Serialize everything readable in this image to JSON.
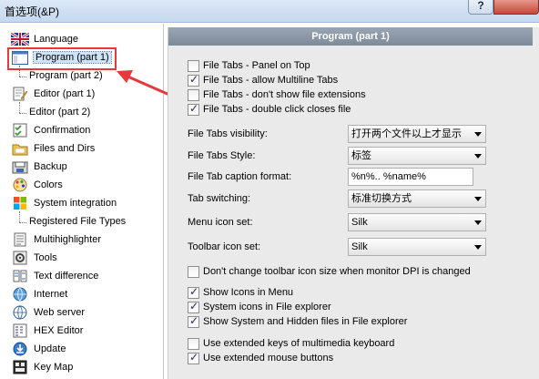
{
  "window": {
    "title": "首选项(&P)",
    "help_label": "?"
  },
  "sidebar": {
    "items": [
      {
        "name": "language",
        "label": "Language",
        "icon": "flag-icon"
      },
      {
        "name": "program-part1",
        "label": "Program  (part 1)",
        "icon": "window-icon",
        "selected": true
      },
      {
        "name": "program-part2",
        "label": "Program  (part 2)",
        "icon": ""
      },
      {
        "name": "editor-part1",
        "label": "Editor  (part 1)",
        "icon": "edit-icon"
      },
      {
        "name": "editor-part2",
        "label": "Editor  (part 2)",
        "icon": ""
      },
      {
        "name": "confirmation",
        "label": "Confirmation",
        "icon": "checklist-icon"
      },
      {
        "name": "files-and-dirs",
        "label": "Files and Dirs",
        "icon": "folder-icon"
      },
      {
        "name": "backup",
        "label": "Backup",
        "icon": "backup-icon"
      },
      {
        "name": "colors",
        "label": "Colors",
        "icon": "palette-icon"
      },
      {
        "name": "system-integration",
        "label": "System integration",
        "icon": "windows-icon"
      },
      {
        "name": "registered-file-types",
        "label": "Registered File Types",
        "icon": ""
      },
      {
        "name": "multihighlighter",
        "label": "Multihighlighter",
        "icon": "document-icon"
      },
      {
        "name": "tools",
        "label": "Tools",
        "icon": "gear-icon"
      },
      {
        "name": "text-difference",
        "label": "Text difference",
        "icon": "diff-icon"
      },
      {
        "name": "internet",
        "label": "Internet",
        "icon": "globe-icon"
      },
      {
        "name": "web-server",
        "label": "Web server",
        "icon": "web-icon"
      },
      {
        "name": "hex-editor",
        "label": "HEX Editor",
        "icon": "hex-icon"
      },
      {
        "name": "update",
        "label": "Update",
        "icon": "update-icon"
      },
      {
        "name": "key-map",
        "label": "Key Map",
        "icon": "keyboard-icon"
      }
    ]
  },
  "panel": {
    "header": "Program  (part 1)",
    "checks_top": [
      {
        "label": "File Tabs - Panel on Top",
        "checked": false
      },
      {
        "label": "File Tabs - allow Multiline Tabs",
        "checked": true
      },
      {
        "label": "File Tabs - don't show file extensions",
        "checked": false
      },
      {
        "label": "File Tabs - double click closes file",
        "checked": true
      }
    ],
    "fields": {
      "visibility_label": "File Tabs visibility:",
      "visibility_value": "打开两个文件以上才显示",
      "style_label": "File Tabs Style:",
      "style_value": "标签",
      "caption_label": "File Tab caption format:",
      "caption_value": "%n%.. %name%",
      "switching_label": "Tab switching:",
      "switching_value": "标准切换方式",
      "menu_icon_label": "Menu icon set:",
      "menu_icon_value": "Silk",
      "toolbar_icon_label": "Toolbar icon set:",
      "toolbar_icon_value": "Silk"
    },
    "check_dpi": {
      "label": "Don't change toolbar icon size when monitor DPI is changed",
      "checked": false
    },
    "checks_mid": [
      {
        "label": "Show Icons in Menu",
        "checked": true
      },
      {
        "label": "System icons in File explorer",
        "checked": true
      },
      {
        "label": "Show System and Hidden files in File explorer",
        "checked": true
      }
    ],
    "checks_bottom": [
      {
        "label": "Use extended keys of multimedia keyboard",
        "checked": false
      },
      {
        "label": "Use extended mouse buttons",
        "checked": true
      }
    ]
  },
  "colors": {
    "highlight": "#e43a3a",
    "header": "#8794a3"
  }
}
